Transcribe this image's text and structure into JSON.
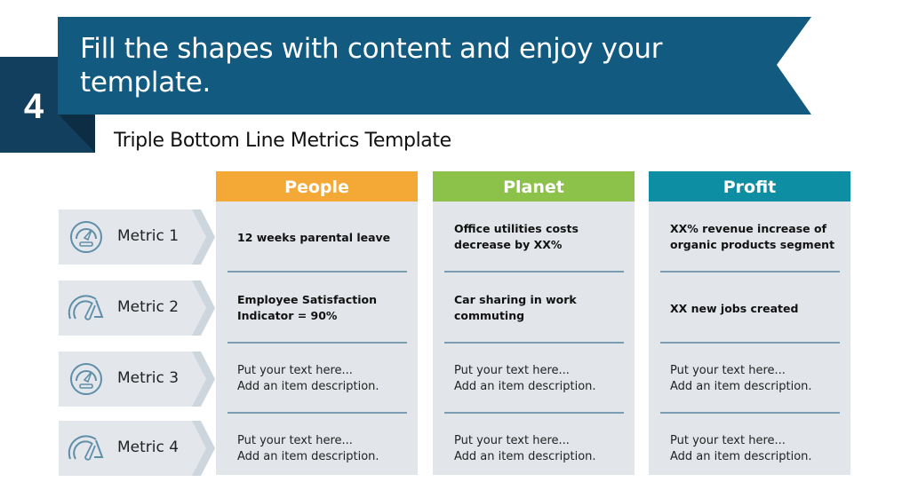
{
  "header": {
    "step_number": "4",
    "title_line1": "Fill the shapes with content and enjoy your",
    "title_line2": "template.",
    "subtitle": "Triple Bottom Line Metrics Template"
  },
  "colors": {
    "banner": "#135a80",
    "step_block": "#123f5e",
    "step_fold": "#0d2d44",
    "people": "#f4a836",
    "planet": "#8cc24a",
    "profit": "#0e8ea3",
    "cell_bg": "#e2e6eb",
    "divider": "#7b9db3",
    "icon": "#5f8ea8"
  },
  "metrics": [
    {
      "label": "Metric 1",
      "icon": "speedometer-circle-icon"
    },
    {
      "label": "Metric 2",
      "icon": "gauge-arc-icon"
    },
    {
      "label": "Metric 3",
      "icon": "speedometer-circle-icon"
    },
    {
      "label": "Metric 4",
      "icon": "gauge-arc-icon"
    }
  ],
  "columns": [
    {
      "title": "People",
      "cells": [
        {
          "line1": "12 weeks parental leave",
          "line2": ""
        },
        {
          "line1": "Employee Satisfaction",
          "line2": "Indicator = 90%"
        },
        {
          "line1": "Put your text here...",
          "line2": "Add an item description."
        },
        {
          "line1": "Put your text here...",
          "line2": "Add an item description."
        }
      ]
    },
    {
      "title": "Planet",
      "cells": [
        {
          "line1": "Office utilities costs",
          "line2": "decrease by XX%"
        },
        {
          "line1": "Car sharing in work",
          "line2": "commuting"
        },
        {
          "line1": "Put your text here...",
          "line2": "Add an item description."
        },
        {
          "line1": "Put your text here...",
          "line2": "Add an item description."
        }
      ]
    },
    {
      "title": "Profit",
      "cells": [
        {
          "line1": "XX% revenue increase of",
          "line2": "organic products segment"
        },
        {
          "line1": "XX new jobs created",
          "line2": ""
        },
        {
          "line1": "Put your text here...",
          "line2": "Add an item description."
        },
        {
          "line1": "Put your text here...",
          "line2": "Add an item description."
        }
      ]
    }
  ]
}
